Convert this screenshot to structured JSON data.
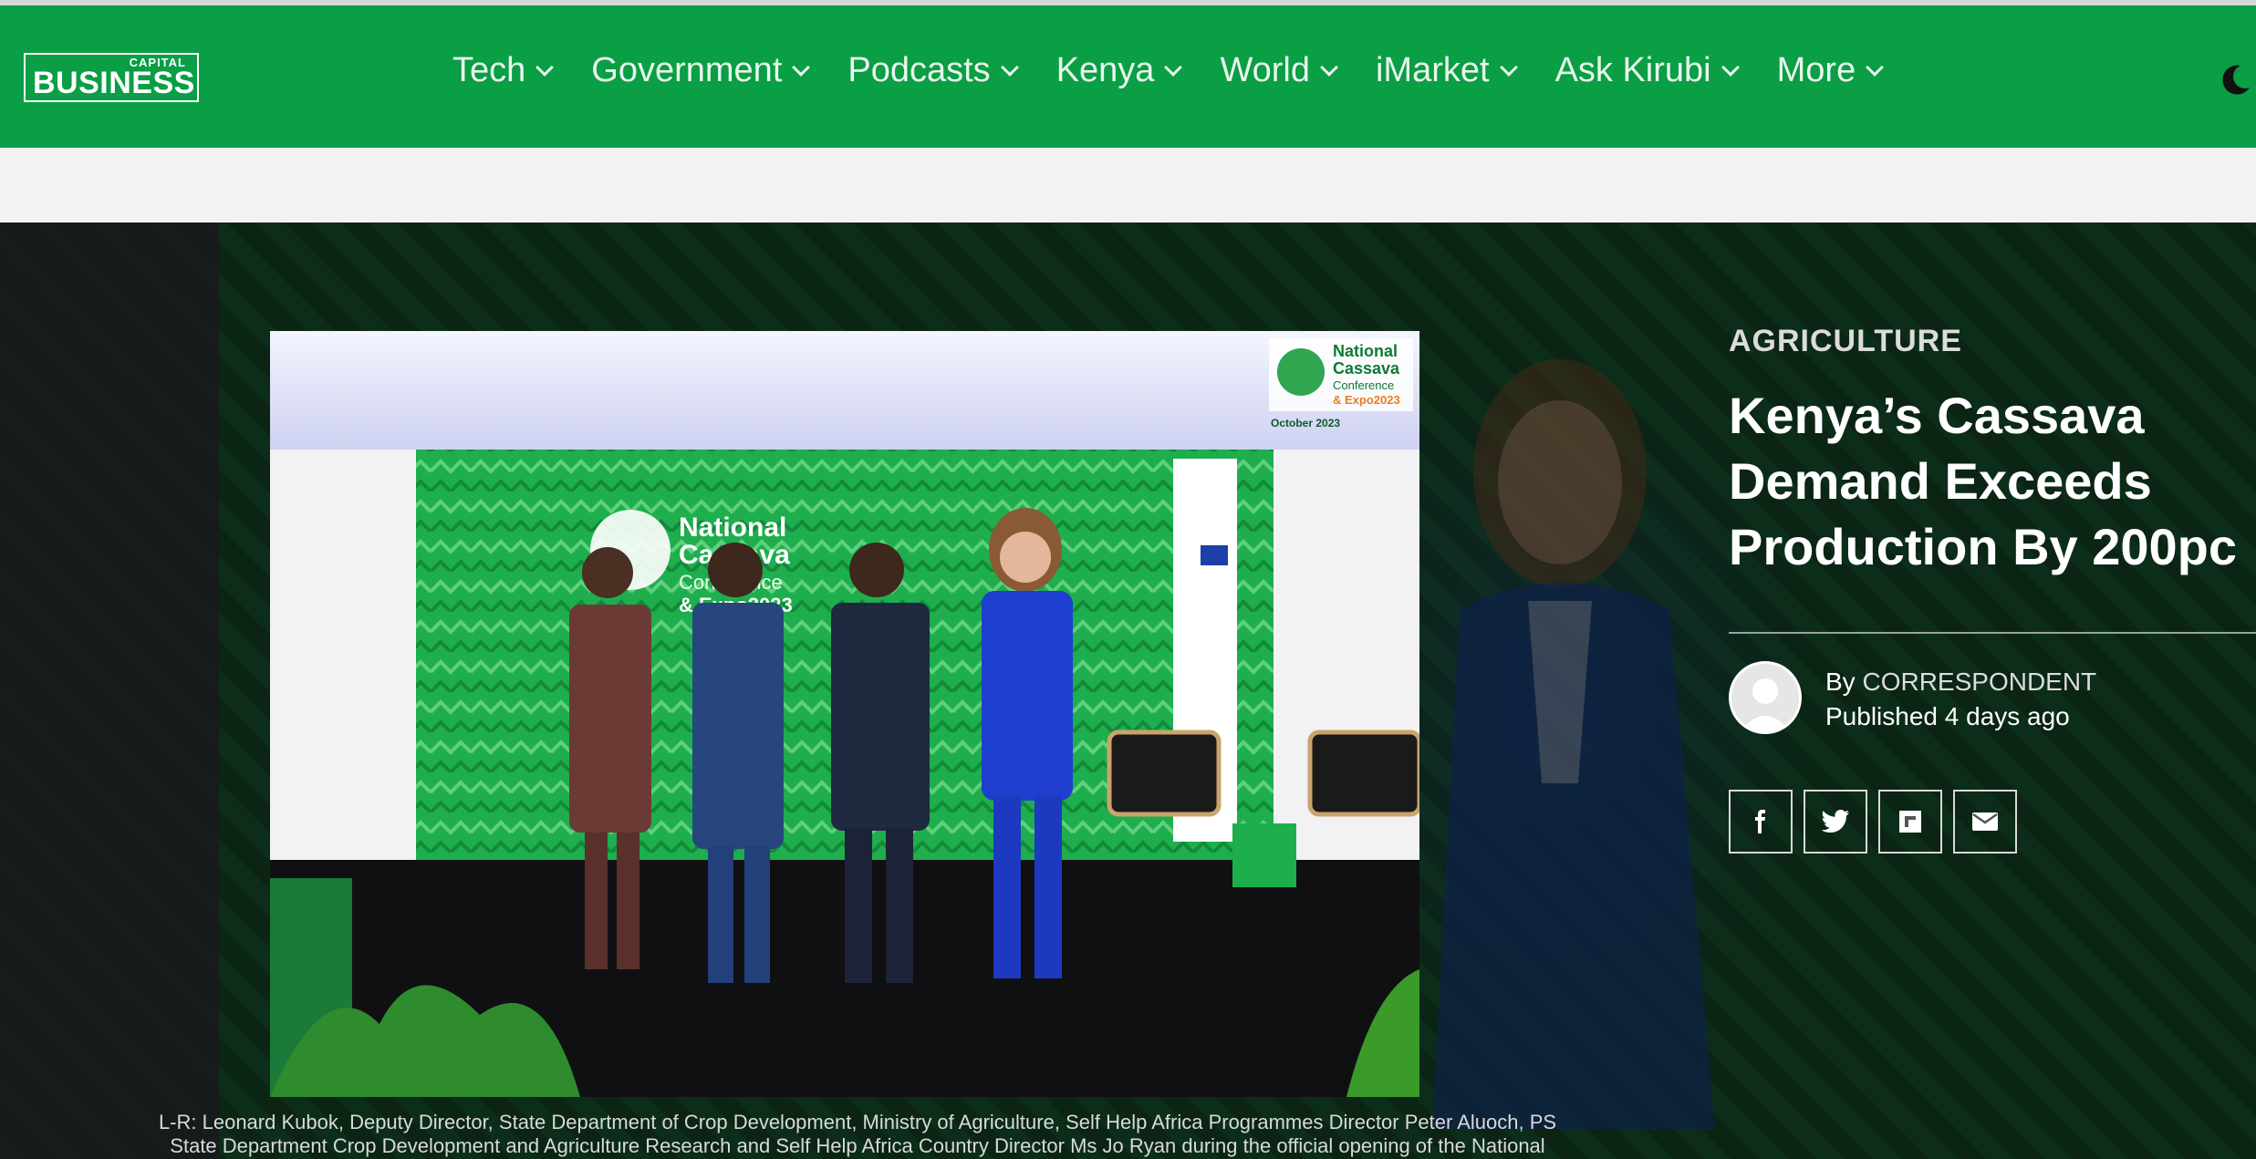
{
  "header": {
    "logo": {
      "small": "CAPITAL",
      "main": "BUSINESS"
    },
    "nav": [
      {
        "label": "Tech"
      },
      {
        "label": "Government"
      },
      {
        "label": "Podcasts"
      },
      {
        "label": "Kenya"
      },
      {
        "label": "World"
      },
      {
        "label": "iMarket"
      },
      {
        "label": "Ask Kirubi"
      },
      {
        "label": "More"
      }
    ],
    "theme_icon": "moon-icon"
  },
  "article": {
    "category": "AGRICULTURE",
    "headline": "Kenya’s Cassava Demand Exceeds Production By 200pc",
    "by_prefix": "By",
    "author": "CORRESPONDENT",
    "published_prefix": "Published",
    "published": "4 days ago",
    "share_icons": [
      "facebook-icon",
      "twitter-icon",
      "flipboard-icon",
      "email-icon"
    ],
    "photo": {
      "banner_title_lines": [
        "National",
        "Cassava",
        "Conference",
        "& Expo2023"
      ],
      "corner_logo_lines": [
        "National",
        "Cassava",
        "Conference",
        "& Expo2023"
      ],
      "corner_date": "October 2023"
    },
    "caption_line1": "L-R: Leonard Kubok, Deputy Director, State Department of Crop Development, Ministry of Agriculture, Self Help Africa Programmes Director Peter Aluoch, PS",
    "caption_line2": "State Department Crop Development and Agriculture Research and Self Help Africa Country Director Ms Jo Ryan during the official opening of the National"
  },
  "colors": {
    "brand_green": "#0a9e45",
    "page_bg": "#f0f0f0"
  }
}
